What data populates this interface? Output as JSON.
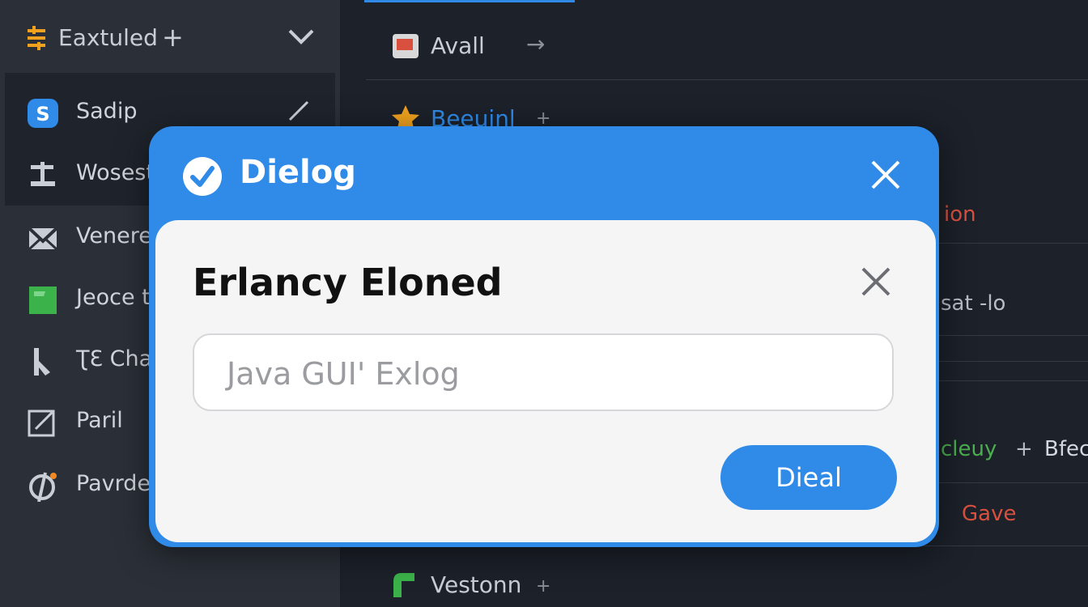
{
  "sidebar": {
    "header": {
      "title": "Eaxtuled",
      "plus": "+",
      "icon": "sliders-icon"
    },
    "items": [
      {
        "label": "Sadip",
        "icon": "s-badge-icon",
        "color": "#2f8ae8"
      },
      {
        "label": "Wosestr",
        "icon": "anvil-icon"
      },
      {
        "label": "Venere",
        "icon": "mail-icon"
      },
      {
        "label": "Jeoce t",
        "icon": "green-square-icon",
        "color": "#3cb34a"
      },
      {
        "label": "ƮƐ Chau",
        "icon": "cursor-icon"
      },
      {
        "label": "Paril",
        "icon": "external-icon"
      },
      {
        "label": "Pavrde",
        "icon": "phi-icon",
        "color": "#f08a24"
      }
    ]
  },
  "main": {
    "tab": {
      "label": "Avall",
      "icon": "app-icon",
      "arrow": "→"
    },
    "favorite": {
      "label": "Beeuinl",
      "suffix": "+"
    },
    "rows": [
      {
        "text": "ion",
        "color": "#d9503f"
      },
      {
        "text": "sat -lo",
        "color": "#b8bdc5"
      },
      {
        "text": "cleuy",
        "color": "#4caf50"
      },
      {
        "text": "+",
        "color": "#b8bdc5"
      },
      {
        "text": "Bfec",
        "color": "#d4d8de"
      },
      {
        "text": "Gave",
        "color": "#d9503f"
      }
    ],
    "footer": {
      "label": "Vestonn",
      "suffix": "+"
    }
  },
  "dialog": {
    "title": "Dielog",
    "heading": "Erlancy Eloned",
    "input_placeholder": "Java GUI' Exlog",
    "button_label": "Dieal",
    "accent": "#2f8ae8"
  }
}
